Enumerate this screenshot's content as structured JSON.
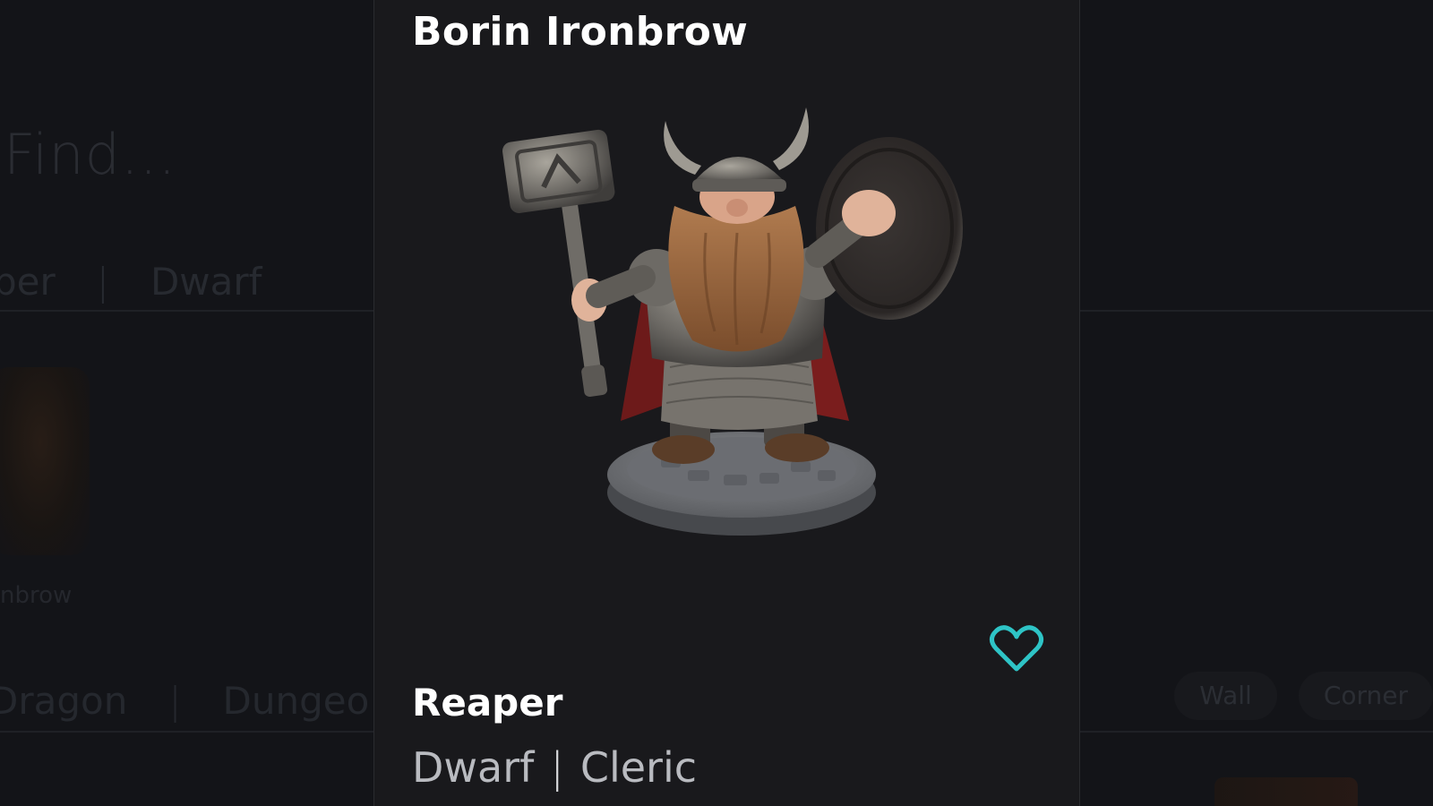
{
  "background": {
    "search_placeholder": "Find...",
    "top_filters": [
      "per",
      "Dwarf"
    ],
    "thumb_label": "nbrow",
    "bottom_filters": [
      "Dragon",
      "Dungeo"
    ],
    "chips": [
      "Wall",
      "Corner"
    ]
  },
  "modal": {
    "title": "Borin Ironbrow",
    "image_icon": "dwarf-cleric-miniature",
    "favorite_icon": "heart-outline-icon",
    "favorite_color": "#2ec4c6",
    "name": "Reaper",
    "tags": [
      "Dwarf",
      "Cleric"
    ],
    "tag_separator": "|"
  }
}
